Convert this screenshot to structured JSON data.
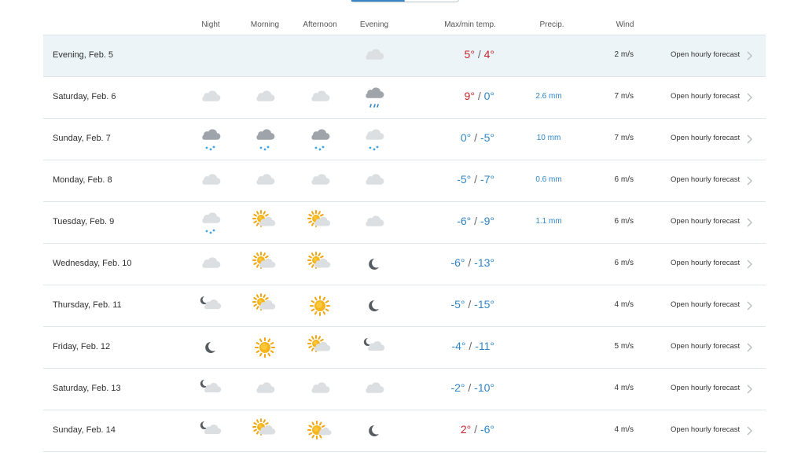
{
  "columns": {
    "night": "Night",
    "morning": "Morning",
    "afternoon": "Afternoon",
    "evening": "Evening",
    "maxmin": "Max/min temp.",
    "precip": "Precip.",
    "wind": "Wind"
  },
  "colors": {
    "warm": "#c1272d",
    "cold": "#2f86c8",
    "highlight": "#ecf4f8",
    "accent": "#3a85c6"
  },
  "rows": [
    {
      "date": "Evening, Feb. 5",
      "icons": [
        "",
        "",
        "",
        "cloud"
      ],
      "max": "5°",
      "min": "4°",
      "max_warm": true,
      "min_warm": true,
      "precip": "",
      "wind": "2 m/s",
      "link": "Open hourly forecast",
      "highlight": true
    },
    {
      "date": "Saturday, Feb. 6",
      "icons": [
        "cloud",
        "cloud",
        "cloud",
        "rain-cloud"
      ],
      "max": "9°",
      "min": "0°",
      "max_warm": true,
      "min_warm": false,
      "precip": "2.6 mm",
      "wind": "7 m/s",
      "link": "Open hourly forecast"
    },
    {
      "date": "Sunday, Feb. 7",
      "icons": [
        "snow-cloud-dark",
        "snow-cloud-dark",
        "snow-cloud-dark",
        "snow-cloud"
      ],
      "max": "0°",
      "min": "-5°",
      "max_warm": false,
      "min_warm": false,
      "precip": "10 mm",
      "wind": "7 m/s",
      "link": "Open hourly forecast"
    },
    {
      "date": "Monday, Feb. 8",
      "icons": [
        "cloud",
        "cloud",
        "cloud",
        "cloud"
      ],
      "max": "-5°",
      "min": "-7°",
      "max_warm": false,
      "min_warm": false,
      "precip": "0.6 mm",
      "wind": "6 m/s",
      "link": "Open hourly forecast"
    },
    {
      "date": "Tuesday, Feb. 9",
      "icons": [
        "snow-cloud",
        "partly-sunny",
        "partly-sunny",
        "cloud"
      ],
      "max": "-6°",
      "min": "-9°",
      "max_warm": false,
      "min_warm": false,
      "precip": "1.1 mm",
      "wind": "6 m/s",
      "link": "Open hourly forecast"
    },
    {
      "date": "Wednesday, Feb. 10",
      "icons": [
        "cloud",
        "partly-sunny",
        "partly-sunny",
        "moon"
      ],
      "max": "-6°",
      "min": "-13°",
      "max_warm": false,
      "min_warm": false,
      "precip": "",
      "wind": "6 m/s",
      "link": "Open hourly forecast"
    },
    {
      "date": "Thursday, Feb. 11",
      "icons": [
        "moon-cloud",
        "partly-sunny",
        "sun",
        "moon"
      ],
      "max": "-5°",
      "min": "-15°",
      "max_warm": false,
      "min_warm": false,
      "precip": "",
      "wind": "4 m/s",
      "link": "Open hourly forecast"
    },
    {
      "date": "Friday, Feb. 12",
      "icons": [
        "moon",
        "sun",
        "partly-sunny",
        "moon-cloud"
      ],
      "max": "-4°",
      "min": "-11°",
      "max_warm": false,
      "min_warm": false,
      "precip": "",
      "wind": "5 m/s",
      "link": "Open hourly forecast"
    },
    {
      "date": "Saturday, Feb. 13",
      "icons": [
        "moon-cloud",
        "cloud",
        "cloud",
        "cloud"
      ],
      "max": "-2°",
      "min": "-10°",
      "max_warm": false,
      "min_warm": false,
      "precip": "",
      "wind": "4 m/s",
      "link": "Open hourly forecast"
    },
    {
      "date": "Sunday, Feb. 14",
      "icons": [
        "moon-cloud",
        "partly-sunny",
        "sun-cloud-small",
        "moon"
      ],
      "max": "2°",
      "min": "-6°",
      "max_warm": true,
      "min_warm": false,
      "precip": "",
      "wind": "4 m/s",
      "link": "Open hourly forecast"
    }
  ]
}
